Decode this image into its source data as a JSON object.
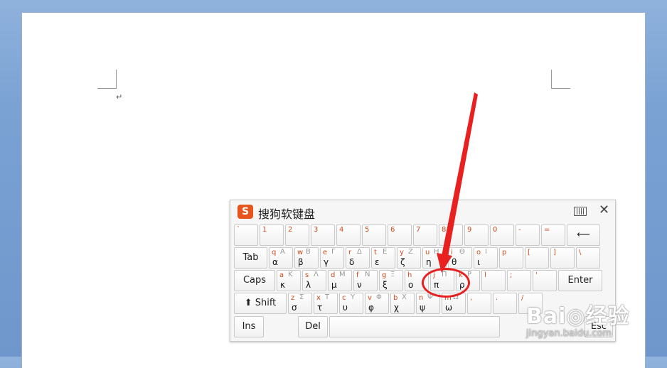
{
  "keyboard": {
    "title": "搜狗软键盘",
    "logo_glyph": "S",
    "close_glyph": "✕",
    "rows": [
      [
        {
          "id": "backtick",
          "tl": "`"
        },
        {
          "id": "1",
          "tl": "1"
        },
        {
          "id": "2",
          "tl": "2"
        },
        {
          "id": "3",
          "tl": "3"
        },
        {
          "id": "4",
          "tl": "4"
        },
        {
          "id": "5",
          "tl": "5"
        },
        {
          "id": "6",
          "tl": "6"
        },
        {
          "id": "7",
          "tl": "7"
        },
        {
          "id": "8",
          "tl": "8"
        },
        {
          "id": "9",
          "tl": "9"
        },
        {
          "id": "0",
          "tl": "0"
        },
        {
          "id": "minus",
          "tl": "-"
        },
        {
          "id": "equals",
          "tl": "="
        },
        {
          "id": "backspace",
          "label": "⟵",
          "fn": true
        }
      ],
      [
        {
          "id": "tab",
          "label": "Tab",
          "fn": true
        },
        {
          "id": "q",
          "tl": "q",
          "tr": "A",
          "g": "α"
        },
        {
          "id": "w",
          "tl": "w",
          "tr": "B",
          "g": "β"
        },
        {
          "id": "e",
          "tl": "e",
          "tr": "Γ",
          "g": "γ"
        },
        {
          "id": "r",
          "tl": "r",
          "tr": "Δ",
          "g": "δ"
        },
        {
          "id": "t",
          "tl": "t",
          "tr": "E",
          "g": "ε"
        },
        {
          "id": "y",
          "tl": "y",
          "tr": "Z",
          "g": "ζ"
        },
        {
          "id": "u",
          "tl": "u",
          "tr": "H",
          "g": "η"
        },
        {
          "id": "i",
          "tl": "i",
          "tr": "Θ",
          "g": "θ"
        },
        {
          "id": "o",
          "tl": "o",
          "tr": "I",
          "g": "ι"
        },
        {
          "id": "p",
          "tl": "p"
        },
        {
          "id": "lbracket",
          "tl": "["
        },
        {
          "id": "rbracket",
          "tl": "]"
        },
        {
          "id": "backslash",
          "tl": "\\"
        }
      ],
      [
        {
          "id": "caps",
          "label": "Caps",
          "fn": true
        },
        {
          "id": "a",
          "tl": "a",
          "tr": "K",
          "g": "κ"
        },
        {
          "id": "s",
          "tl": "s",
          "tr": "Λ",
          "g": "λ"
        },
        {
          "id": "d",
          "tl": "d",
          "tr": "M",
          "g": "μ"
        },
        {
          "id": "f",
          "tl": "f",
          "tr": "N",
          "g": "ν"
        },
        {
          "id": "g",
          "tl": "g",
          "tr": "Ξ",
          "g": "ξ"
        },
        {
          "id": "h",
          "tl": "h",
          "g": "ο"
        },
        {
          "id": "j",
          "tl": "j",
          "tr": "Π",
          "g": "π"
        },
        {
          "id": "k",
          "tl": "k",
          "tr": "P",
          "g": "ρ"
        },
        {
          "id": "l",
          "tl": "l"
        },
        {
          "id": "semicolon",
          "tl": ";"
        },
        {
          "id": "quote",
          "tl": "'"
        },
        {
          "id": "enter",
          "label": "Enter",
          "fn": true
        }
      ],
      [
        {
          "id": "shift",
          "label": "⬆ Shift",
          "fn": true
        },
        {
          "id": "z",
          "tl": "z",
          "tr": "Σ",
          "g": "σ"
        },
        {
          "id": "x",
          "tl": "x",
          "tr": "T",
          "g": "τ"
        },
        {
          "id": "c",
          "tl": "c",
          "tr": "Υ",
          "g": "υ"
        },
        {
          "id": "v",
          "tl": "v",
          "tr": "Φ",
          "g": "φ"
        },
        {
          "id": "b",
          "tl": "b",
          "tr": "X",
          "g": "χ"
        },
        {
          "id": "n",
          "tl": "n",
          "tr": "Ψ",
          "g": "ψ"
        },
        {
          "id": "m",
          "tl": "m",
          "tr": "Ω",
          "g": "ω"
        },
        {
          "id": "comma",
          "tl": ","
        },
        {
          "id": "period",
          "tl": "."
        },
        {
          "id": "slash",
          "tl": "/"
        }
      ],
      [
        {
          "id": "ins",
          "label": "Ins",
          "fn": true
        },
        {
          "id": "del",
          "label": "Del",
          "fn": true
        },
        {
          "id": "space",
          "label": "",
          "fn": true
        },
        {
          "id": "esc",
          "label": "Esc",
          "fn": true
        }
      ]
    ]
  },
  "watermark": {
    "main": "Bai◎经验",
    "sub": "jingyan.baidu.com"
  },
  "colors": {
    "annotation": "#e82020",
    "key_letter": "#d04a1a"
  }
}
